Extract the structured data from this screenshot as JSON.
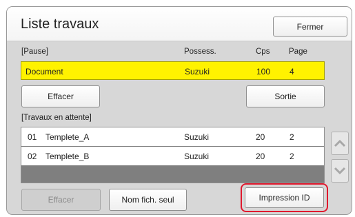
{
  "window": {
    "title": "Liste travaux",
    "close_label": "Fermer"
  },
  "paused": {
    "section_label": "[Pause]",
    "columns": {
      "owner": "Possess.",
      "copies": "Cps",
      "page": "Page"
    },
    "row": {
      "name": "Document",
      "owner": "Suzuki",
      "copies": "100",
      "page": "4"
    },
    "delete_label": "Effacer",
    "exit_label": "Sortie"
  },
  "waiting": {
    "section_label": "[Travaux en attente]",
    "rows": [
      {
        "num": "01",
        "name": "Templete_A",
        "owner": "Suzuki",
        "copies": "20",
        "page": "2"
      },
      {
        "num": "02",
        "name": "Templete_B",
        "owner": "Suzuki",
        "copies": "20",
        "page": "2"
      }
    ]
  },
  "footer": {
    "delete_label": "Effacer",
    "name_only_label": "Nom fich. seul",
    "print_id_label": "Impression ID"
  },
  "colors": {
    "paused_row": "#fff200",
    "highlight": "#e0182d"
  },
  "icons": {
    "scroll_up": "chevron-up-icon",
    "scroll_down": "chevron-down-icon"
  }
}
